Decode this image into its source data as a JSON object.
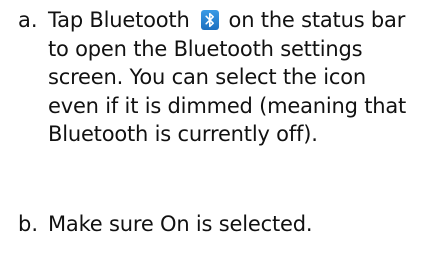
{
  "steps": [
    {
      "marker": "a.",
      "before_icon": "Tap Bluetooth",
      "icon": "bluetooth-icon",
      "after_icon": "on the status bar to open the Bluetooth settings screen. You can select the icon even if it is dimmed (meaning that Bluetooth is currently off)."
    },
    {
      "marker": "b.",
      "text": "Make sure On is selected."
    }
  ],
  "colors": {
    "icon_background": "#1b7fd0",
    "icon_glyph": "#ffffff"
  }
}
